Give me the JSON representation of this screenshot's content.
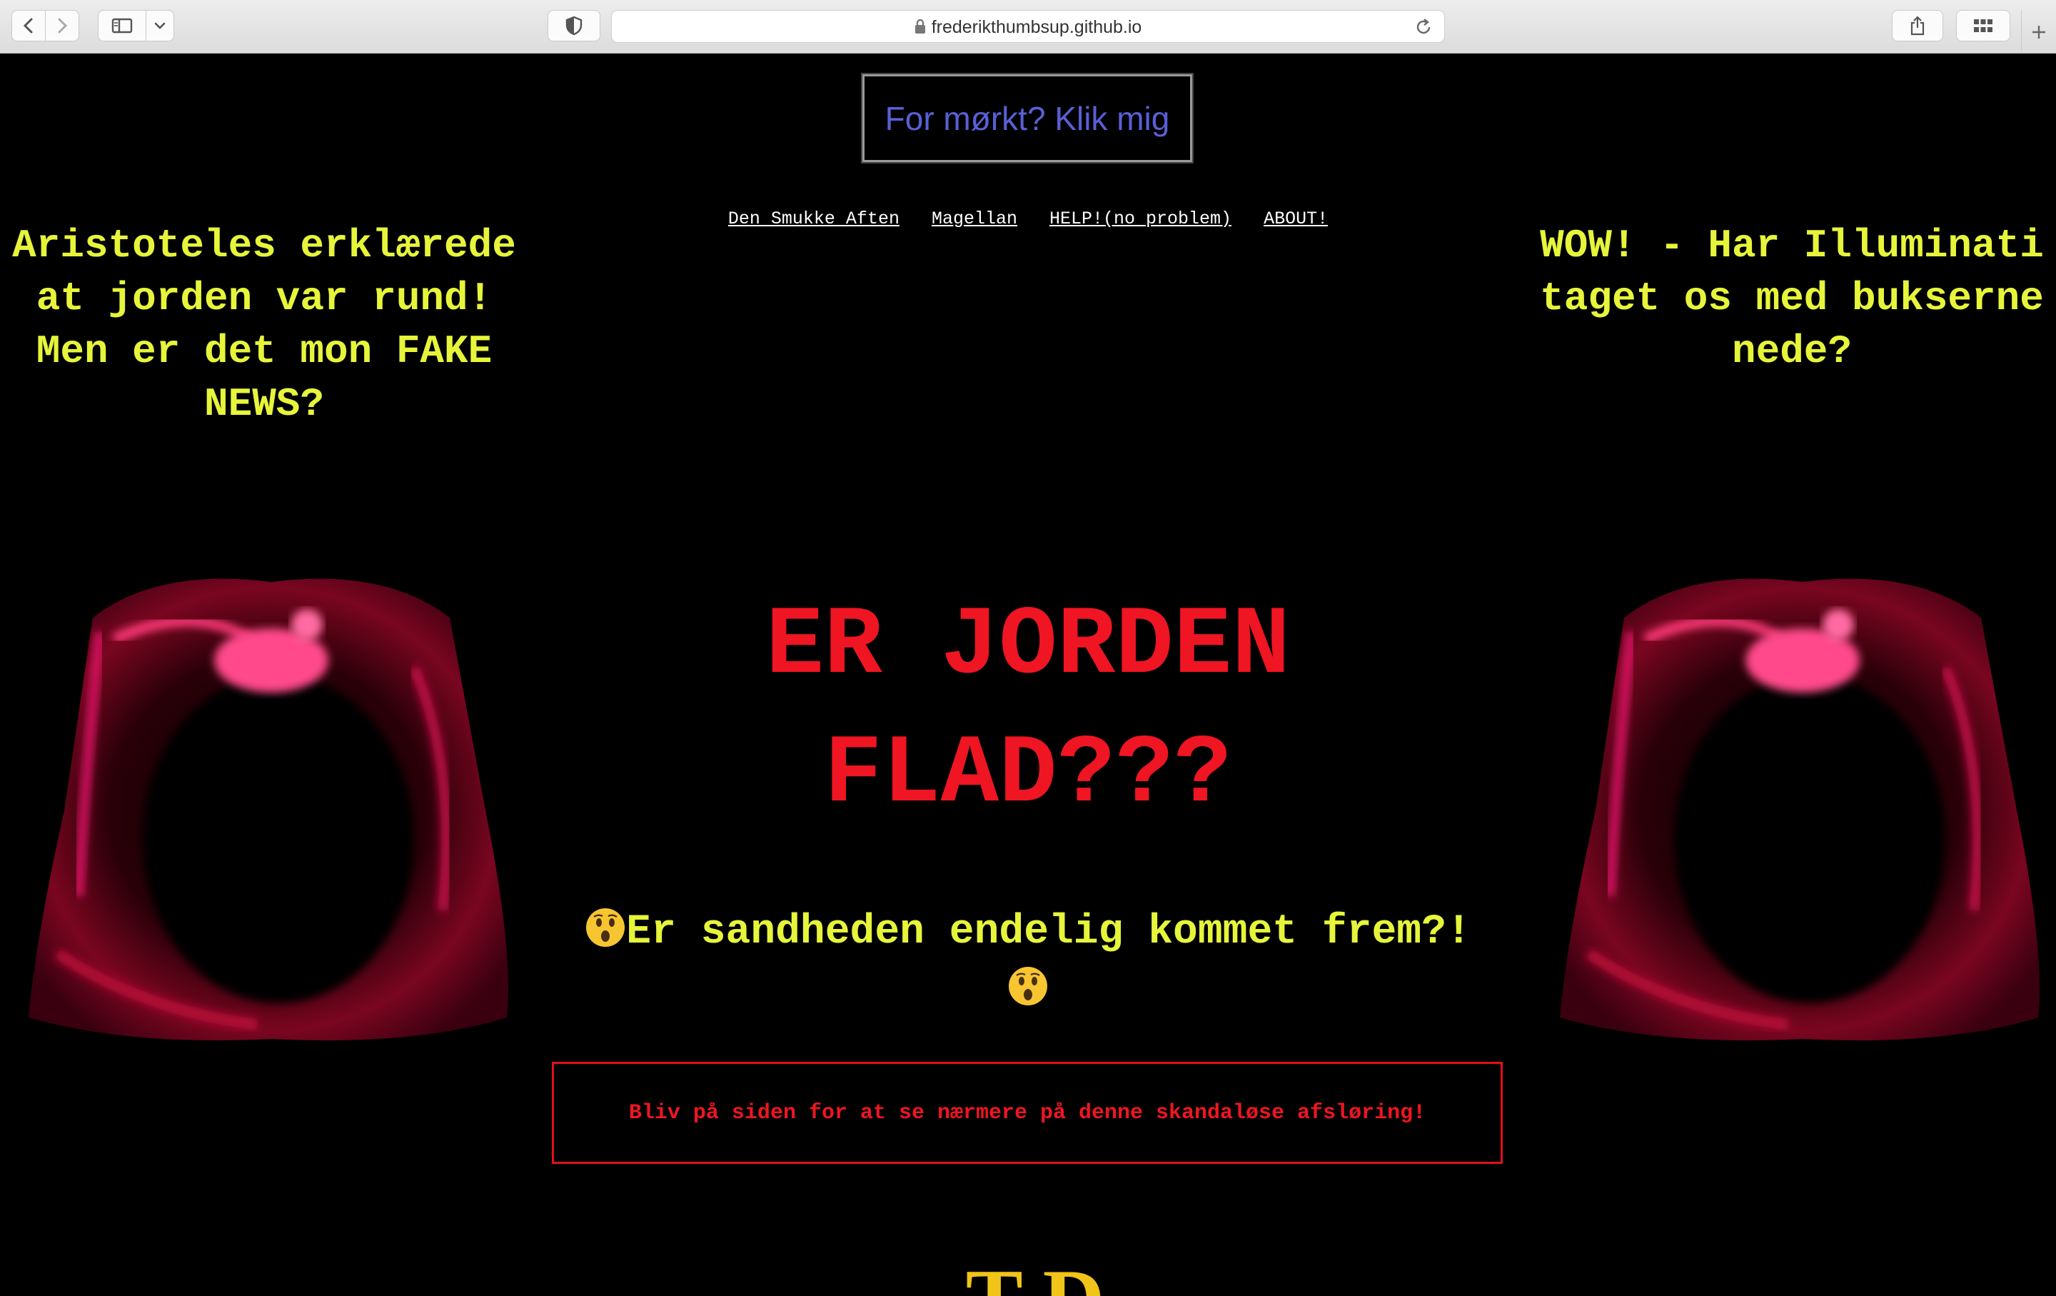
{
  "browser": {
    "url": "frederikthumbsup.github.io",
    "icons": [
      "back-icon",
      "forward-icon",
      "sidebar-icon",
      "chevron-down-icon",
      "shield-icon",
      "lock-icon",
      "reload-icon",
      "share-icon",
      "tab-overview-icon",
      "plus-icon"
    ]
  },
  "page": {
    "theme_button": "For mørkt? Klik mig",
    "nav": [
      "Den Smukke Aften",
      "Magellan",
      "HELP!(no problem)",
      "ABOUT!"
    ],
    "left_text": "Aristoteles erklærede at jorden var rund! Men er det mon FAKE NEWS?",
    "right_text": "WOW! - Har Illuminati taget os med bukserne nede?",
    "headline_line1": "ER JORDEN",
    "headline_line2": "FLAD???",
    "subheadline": "Er sandheden endelig kommet frem?!",
    "notice": "Bliv på siden for at se nærmere på denne skandaløse afsløring!",
    "bottom_peek": "T   D",
    "colors": {
      "background": "#000000",
      "accent_yellow": "#e6f53a",
      "accent_red": "#ef1522",
      "link_blue": "#5a5fd6"
    }
  }
}
